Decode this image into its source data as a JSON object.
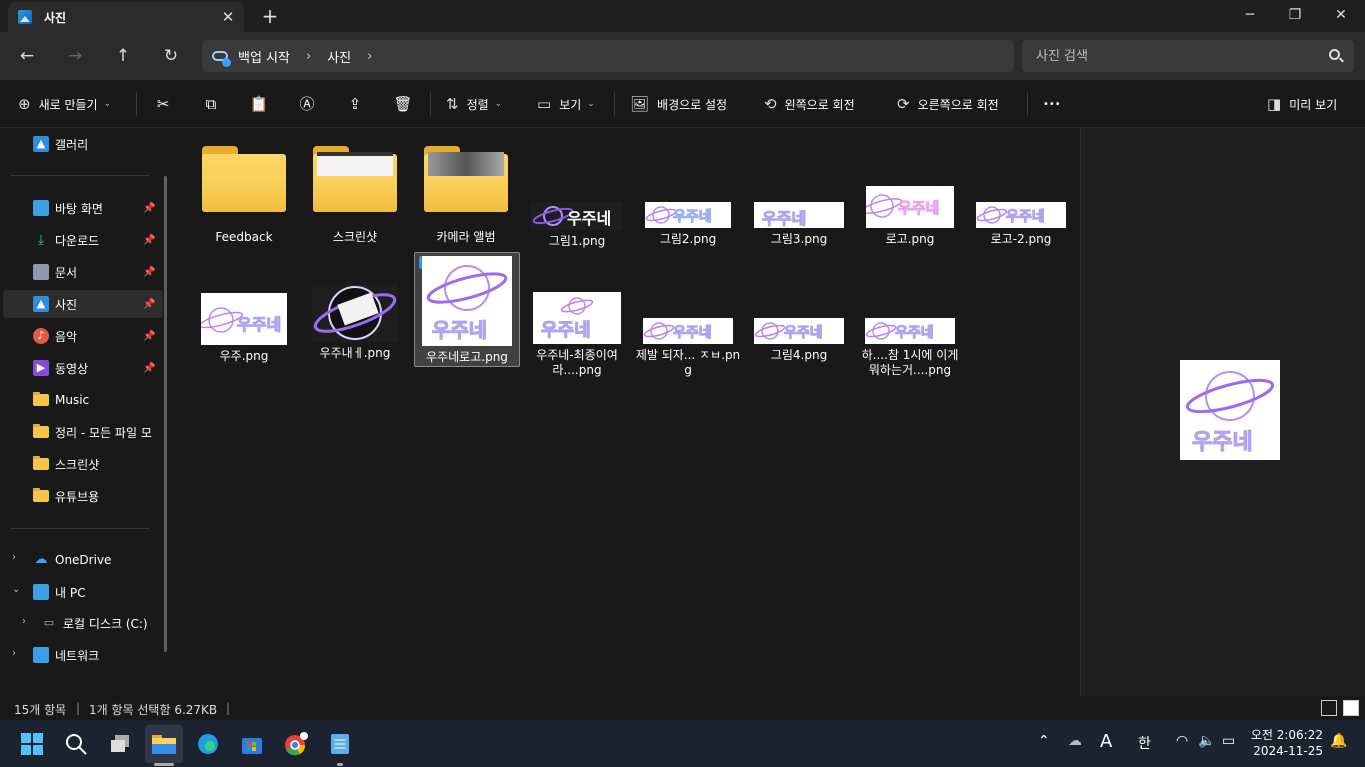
{
  "window": {
    "tab_title": "사진",
    "tab_close": "✕",
    "new_tab": "+",
    "minimize": "─",
    "maximize": "❐",
    "close": "✕"
  },
  "nav": {
    "back": "←",
    "forward": "→",
    "up": "↑",
    "refresh": "↻",
    "breadcrumb": [
      "백업 시작",
      "사진"
    ],
    "crumb_sep": "›",
    "search_placeholder": "사진 검색"
  },
  "commands": {
    "new_label": "새로 만들기",
    "sort_label": "정렬",
    "view_label": "보기",
    "set_background_label": "배경으로 설정",
    "rotate_left_label": "왼쪽으로 회전",
    "rotate_right_label": "오른쪽으로 회전",
    "more_label": "•••",
    "preview_label": "미리 보기"
  },
  "sidebar": {
    "gallery": "갤러리",
    "quick": [
      {
        "label": "바탕 화면",
        "icon": "desktop-icon"
      },
      {
        "label": "다운로드",
        "icon": "download-icon"
      },
      {
        "label": "문서",
        "icon": "document-icon"
      },
      {
        "label": "사진",
        "icon": "pictures-icon"
      },
      {
        "label": "음악",
        "icon": "music-icon"
      },
      {
        "label": "동영상",
        "icon": "video-icon"
      }
    ],
    "folders": [
      "Music",
      "정리 - 모든 파일 모",
      "스크린샷",
      "유튜브용"
    ],
    "onedrive": "OneDrive",
    "this_pc": "내 PC",
    "local_disk": "로컬 디스크 (C:)",
    "network": "네트워크"
  },
  "files": {
    "row1": [
      "Feedback",
      "스크린샷",
      "카메라 앨범",
      "그림1.png",
      "그림2.png",
      "그림3.png",
      "로고.png",
      "로고-2.png"
    ],
    "row2": [
      "우주.png",
      "우주내ㅔ.png",
      "우주네로고.png",
      "우주네-최종이여라....png",
      "제발 되자... ㅈㅂ.png",
      "그림4.png",
      "하....참 1시에 이게 뭐하는거....png"
    ],
    "logo_word": "우주네",
    "selected": "우주네로고.png"
  },
  "status": {
    "count": "15개 항목",
    "selection": "1개 항목 선택함 6.27KB",
    "sep": "|"
  },
  "taskbar": {
    "time": "오전 2:06:22",
    "date": "2024-11-25",
    "ime_a": "A",
    "ime_han": "한",
    "chevron": "⌃"
  },
  "colors": {
    "accent": "#3a8de8",
    "folder": "#f5c64b",
    "logo_purple": "#9b6bf2"
  }
}
